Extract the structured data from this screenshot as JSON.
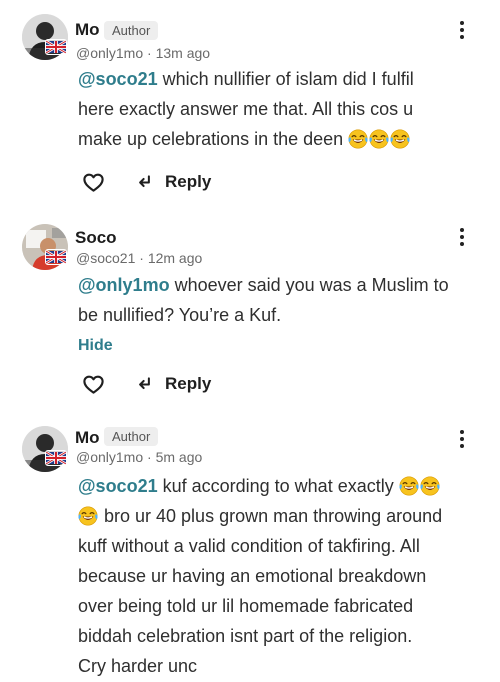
{
  "comments": [
    {
      "author": "Mo",
      "badge": "Author",
      "handle": "@only1mo",
      "time": "13m ago",
      "mention": "@soco21",
      "line1": " which nullifier of islam did I fulfil",
      "line2": "here exactly answer me that. All this cos u",
      "line3": "make up celebrations in the deen",
      "reply_label": "Reply",
      "avatar_icon": "profile-photo-silhouette",
      "flag_icon": "uk-flag"
    },
    {
      "author": "Soco",
      "handle": "@soco21",
      "time": "12m ago",
      "mention": "@only1mo",
      "line1": " whoever said you was a Muslim to",
      "line2": "be nullified? You’re a Kuf.",
      "hide_label": "Hide",
      "reply_label": "Reply",
      "avatar_icon": "profile-photo",
      "flag_icon": "uk-flag"
    },
    {
      "author": "Mo",
      "badge": "Author",
      "handle": "@only1mo",
      "time": "5m ago",
      "mention": "@soco21",
      "line1": " kuf according to what exactly",
      "line2": " bro ur 40 plus grown man throwing around",
      "line3": "kuff without a valid condition of takfiring. All",
      "line4": "because ur having an emotional breakdown",
      "line5": "over being told ur lil homemade fabricated",
      "line6": "biddah celebration isnt part of the religion.",
      "line7": "Cry harder unc",
      "avatar_icon": "profile-photo-silhouette",
      "flag_icon": "uk-flag"
    }
  ],
  "separator": " · ",
  "colors": {
    "mention": "#2f7d8c",
    "text": "#2f2f2f",
    "muted": "#6a6a6a"
  }
}
